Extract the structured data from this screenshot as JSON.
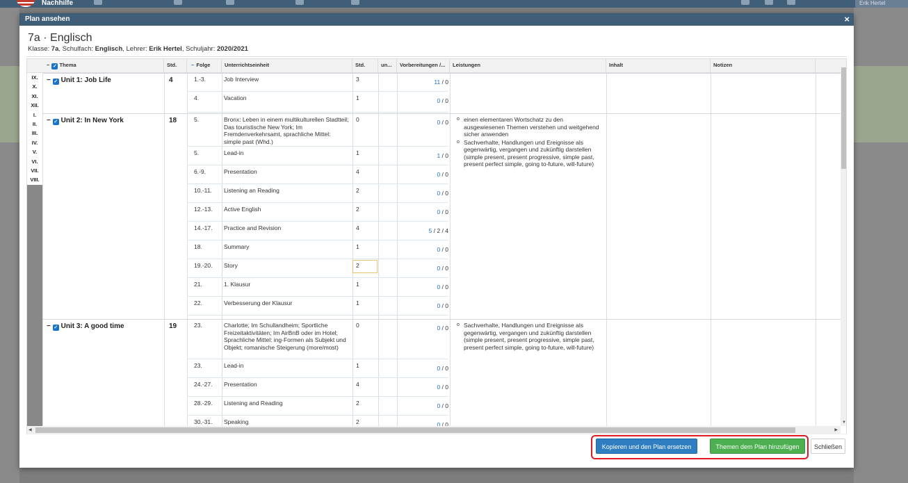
{
  "app": {
    "brand": "Nachhilfe",
    "user": "Erik Hertel"
  },
  "modal": {
    "header": "Plan ansehen",
    "close_glyph": "×",
    "title": "7a · Englisch",
    "sub": {
      "klasse_label": "Klasse: ",
      "klasse": "7a",
      "fach_label": ", Schulfach: ",
      "fach": "Englisch",
      "lehrer_label": ", Lehrer: ",
      "lehrer": "Erik Hertel",
      "jahr_label": ", Schuljahr: ",
      "jahr": "2020/2021"
    }
  },
  "columns": {
    "thema": "Thema",
    "std": "Std.",
    "folge": "Folge",
    "unterrichtseinheit": "Unterrichtseinheit",
    "std2": "Std.",
    "un": "un...",
    "vorbereitungen": "Vorbereitungen /...",
    "leistungen": "Leistungen",
    "inhalt": "Inhalt",
    "notizen": "Notizen"
  },
  "roman": [
    "IX.",
    "X.",
    "XI.",
    "XII.",
    "I.",
    "II.",
    "III.",
    "IV.",
    "V.",
    "VI.",
    "VII.",
    "VIII."
  ],
  "units": [
    {
      "title": "Unit 1: Job Life",
      "std": "4",
      "rows": [
        {
          "folge": "1.-3.",
          "ue": "Job Interview",
          "std": "3",
          "vb_done": "11",
          "vb_total": " / 0"
        },
        {
          "folge": "4.",
          "ue": "Vacation",
          "std": "1",
          "vb_done": "0",
          "vb_total": " / 0"
        }
      ],
      "leistungen": []
    },
    {
      "title": "Unit 2: In New York",
      "std": "18",
      "rows": [
        {
          "folge": "5.",
          "ue": "Bronx: Leben in einem multikulturellen Stadtteil; Das touristische New York; Im Fremdenverkehrsamt, sprachliche Mittel: simple past (Whd.)",
          "std": "0",
          "vb_done": "0",
          "vb_total": " / 0"
        },
        {
          "folge": "5.",
          "ue": "Lead-in",
          "std": "1",
          "vb_done": "1",
          "vb_total": " / 0"
        },
        {
          "folge": "6.-9.",
          "ue": "Presentation",
          "std": "4",
          "vb_done": "0",
          "vb_total": " / 0"
        },
        {
          "folge": "10.-11.",
          "ue": "Listening an Reading",
          "std": "2",
          "vb_done": "0",
          "vb_total": " / 0"
        },
        {
          "folge": "12.-13.",
          "ue": "Active English",
          "std": "2",
          "vb_done": "0",
          "vb_total": " / 0"
        },
        {
          "folge": "14.-17.",
          "ue": "Practice and Revision",
          "std": "4",
          "vb_done": "5",
          "vb_total": " / 2 / 4"
        },
        {
          "folge": "18.",
          "ue": "Summary",
          "std": "1",
          "vb_done": "0",
          "vb_total": " / 0"
        },
        {
          "folge": "19.-20.",
          "ue": "Story",
          "std": "2",
          "vb_done": "0",
          "vb_total": " / 0"
        },
        {
          "folge": "21.",
          "ue": "1. Klausur",
          "std": "1",
          "vb_done": "0",
          "vb_total": " / 0"
        },
        {
          "folge": "22.",
          "ue": "Verbesserung der Klausur",
          "std": "1",
          "vb_done": "0",
          "vb_total": " / 0"
        }
      ],
      "leistungen": [
        "einen elementaren Wortschatz zu den ausgewiesenen Themen verstehen und weitgehend sicher anwenden",
        "Sachverhalte, Handlungen und Ereignisse als gegenwärtig, vergangen und zukünftig darstellen (simple present, present progressive, simple past, present perfect simple, going to-future, will-future)"
      ]
    },
    {
      "title": "Unit 3: A good time",
      "std": "19",
      "rows": [
        {
          "folge": "23.",
          "ue": "Charlotte; Im Schullandheim; Sportliche Freizeitaktivitäten; Im AirBnB oder im Hotel; Sprachliche Mittel: ing-Formen als Subjekt und Objekt; romanische Steigerung (more/most)",
          "std": "0",
          "vb_done": "0",
          "vb_total": " / 0"
        },
        {
          "folge": "23.",
          "ue": "Lead-in",
          "std": "1",
          "vb_done": "0",
          "vb_total": " / 0"
        },
        {
          "folge": "24.-27.",
          "ue": "Presentation",
          "std": "4",
          "vb_done": "0",
          "vb_total": " / 0"
        },
        {
          "folge": "28.-29.",
          "ue": "Listening and Reading",
          "std": "2",
          "vb_done": "0",
          "vb_total": " / 0"
        },
        {
          "folge": "30.-31.",
          "ue": "Speaking",
          "std": "2",
          "vb_done": "0",
          "vb_total": " / 0"
        }
      ],
      "leistungen": [
        "Sachverhalte, Handlungen und Ereignisse als gegenwärtig, vergangen und zukünftig darstellen (simple present, present progressive, simple past, present perfect simple, going to-future, will-future)"
      ]
    }
  ],
  "footer": {
    "copy_label": "Kopieren und den Plan ersetzen",
    "add_label": "Themen dem Plan hinzufügen",
    "close_label": "Schließen"
  },
  "colors": {
    "header": "#415e78",
    "primary": "#2f7ec1",
    "success": "#4caf50",
    "highlight": "#e01b24"
  }
}
